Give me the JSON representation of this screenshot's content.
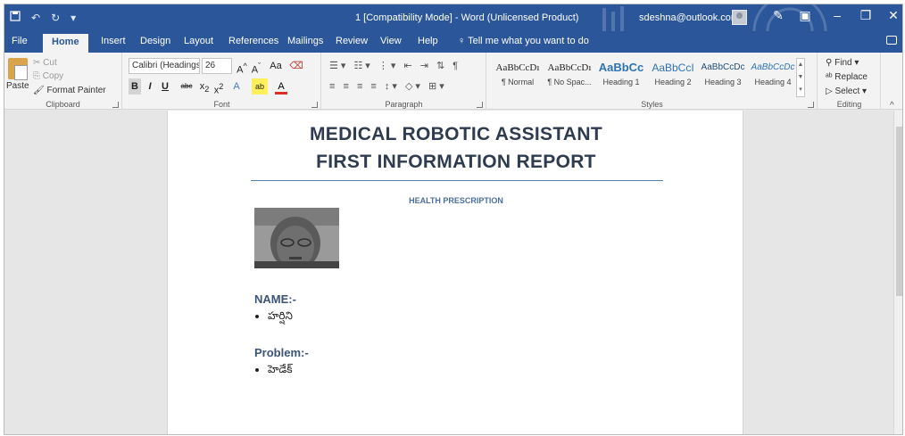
{
  "window": {
    "title": "1 [Compatibility Mode] - Word (Unlicensed Product)",
    "user_email": "sdeshna@outlook.com"
  },
  "tabs": [
    "File",
    "Home",
    "Insert",
    "Design",
    "Layout",
    "References",
    "Mailings",
    "Review",
    "View",
    "Help"
  ],
  "active_tab": "Home",
  "tell_me": "Tell me what you want to do",
  "clipboard": {
    "paste": "Paste",
    "cut": "Cut",
    "copy": "Copy",
    "format_painter": "Format Painter",
    "label": "Clipboard"
  },
  "font": {
    "family": "Calibri (Headings",
    "size": "26",
    "label": "Font"
  },
  "paragraph": {
    "label": "Paragraph"
  },
  "styles": {
    "label": "Styles",
    "items": [
      {
        "sample": "AaBbCcDı",
        "name": "¶ Normal"
      },
      {
        "sample": "AaBbCcDı",
        "name": "¶ No Spac..."
      },
      {
        "sample": "AaBbCc",
        "name": "Heading 1"
      },
      {
        "sample": "AaBbCcI",
        "name": "Heading 2"
      },
      {
        "sample": "AaBbCcDc",
        "name": "Heading 3"
      },
      {
        "sample": "AaBbCcDc",
        "name": "Heading 4"
      }
    ]
  },
  "editing": {
    "find": "Find",
    "replace": "Replace",
    "select": "Select",
    "label": "Editing"
  },
  "document": {
    "title_line1": "MEDICAL ROBOTIC ASSISTANT",
    "title_line2": "FIRST INFORMATION REPORT",
    "subtitle": "HEALTH PRESCRIPTION",
    "name_heading": "NAME:-",
    "name_value": "హర్షిని",
    "problem_heading": "Problem:-",
    "problem_value": "హెడేక్"
  },
  "colors": {
    "word_blue": "#2b579a",
    "heading_blue": "#3b5478",
    "title_dark": "#2f3b4f"
  }
}
